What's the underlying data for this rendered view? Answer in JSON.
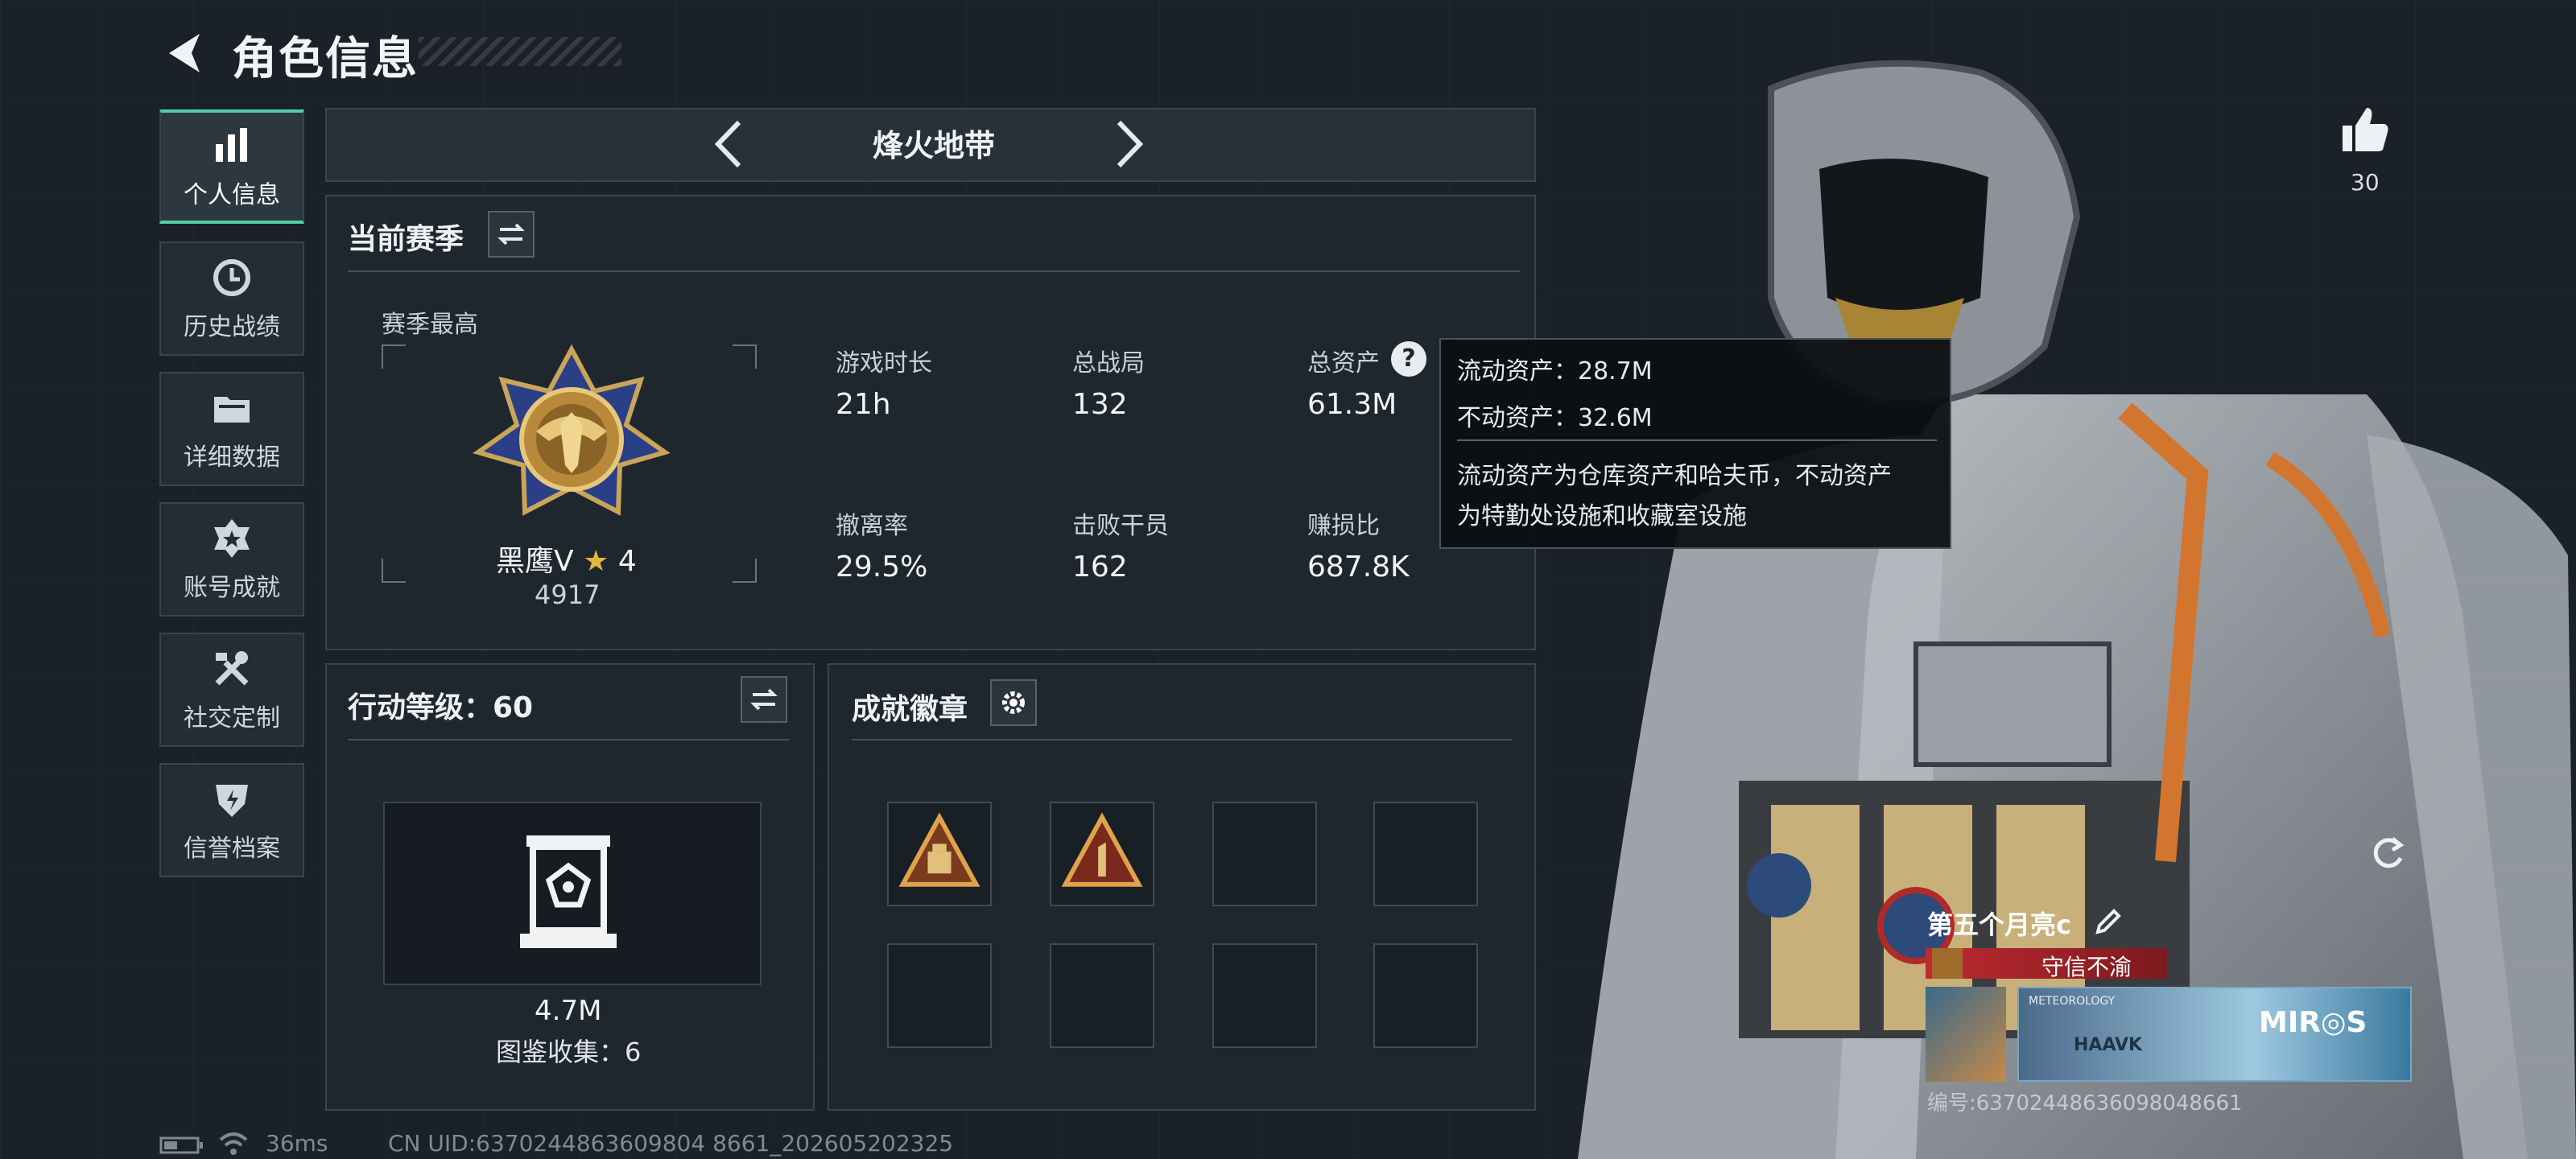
{
  "header": {
    "title": "角色信息"
  },
  "sidebar": {
    "items": [
      {
        "label": "个人信息",
        "icon": "bar-chart-icon",
        "active": true
      },
      {
        "label": "历史战绩",
        "icon": "history-clock-icon",
        "active": false
      },
      {
        "label": "详细数据",
        "icon": "folder-icon",
        "active": false
      },
      {
        "label": "账号成就",
        "icon": "achievement-star-icon",
        "active": false
      },
      {
        "label": "社交定制",
        "icon": "tools-icon",
        "active": false
      },
      {
        "label": "信誉档案",
        "icon": "reputation-shield-icon",
        "active": false
      }
    ]
  },
  "mode": {
    "name": "烽火地带"
  },
  "season": {
    "title": "当前赛季",
    "best_label": "赛季最高",
    "rank_name": "黑鹰V",
    "rank_stars": "4",
    "rank_score": "4917",
    "stats": [
      {
        "label": "游戏时长",
        "value": "21h"
      },
      {
        "label": "总战局",
        "value": "132"
      },
      {
        "label": "总资产",
        "value": "61.3M"
      },
      {
        "label": "撤离率",
        "value": "29.5%"
      },
      {
        "label": "击败干员",
        "value": "162"
      },
      {
        "label": "赚损比",
        "value": "687.8K"
      }
    ]
  },
  "tooltip": {
    "liquid": "流动资产：28.7M",
    "fixed": "不动资产：32.6M",
    "desc_line1": "流动资产为仓库资产和哈夫币，不动资产",
    "desc_line2": "为特勤处设施和收藏室设施"
  },
  "action_level": {
    "title": "行动等级：60",
    "value": "4.7M",
    "collection": "图鉴收集：6"
  },
  "achievements": {
    "title": "成就徽章"
  },
  "like": {
    "count": "30"
  },
  "player": {
    "name": "第五个月亮c",
    "reputation": "守信不渝",
    "card_brand": "MIR◎S",
    "card_sub": "HAAVK",
    "card_small": "METEOROLOGY",
    "id_text": "编号:637024486360980486​61"
  },
  "status_bar": {
    "ping": "36ms",
    "uid": "CN UID:6370244863609804 8661_202605202325"
  },
  "colors": {
    "accent": "#4fd1a5",
    "reputation_red": "#a8242a",
    "bg": "#1a2128"
  }
}
